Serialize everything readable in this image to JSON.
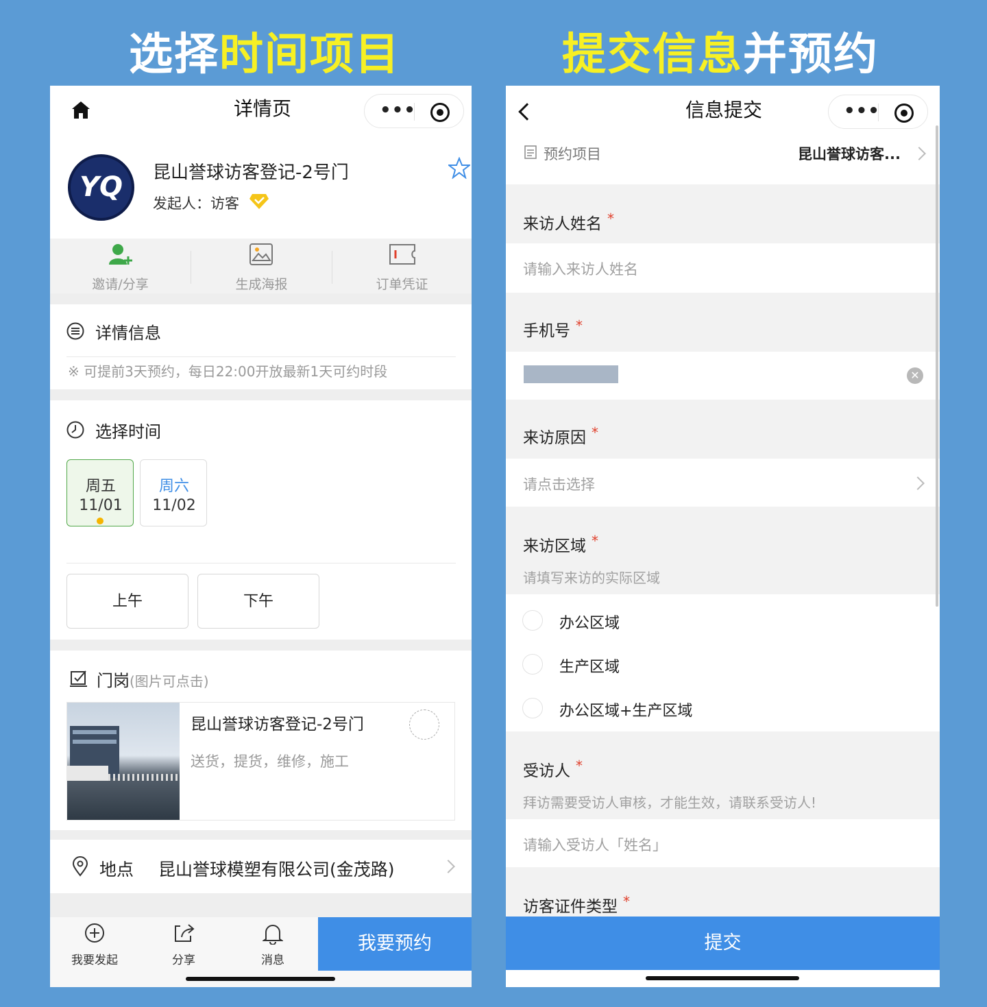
{
  "banners": {
    "left_white": "选择",
    "left_yellow": "时间项目",
    "right_yellow": "提交信息",
    "right_white": "并预约"
  },
  "detail_page": {
    "nav_title": "详情页",
    "capsule_dots": "•••",
    "header": {
      "logo_text": "YQ",
      "title": "昆山誉球访客登记-2号门",
      "initiator": "发起人：访客"
    },
    "actions": [
      "邀请/分享",
      "生成海报",
      "订单凭证"
    ],
    "details": {
      "heading": "详情信息",
      "note": "※ 可提前3天预约，每日22:00开放最新1天可约时段"
    },
    "time": {
      "heading": "选择时间",
      "days": [
        {
          "weekday": "周五",
          "date": "11/01"
        },
        {
          "weekday": "周六",
          "date": "11/02"
        }
      ],
      "slots": [
        "上午",
        "下午"
      ]
    },
    "gate": {
      "heading": "门岗",
      "hint": "(图片可点击)",
      "card_title": "昆山誉球访客登记-2号门",
      "card_desc": "送货，提货，维修，施工"
    },
    "location": {
      "label": "地点",
      "value": "昆山誉球模塑有限公司(金茂路)"
    },
    "tabbar": [
      "我要发起",
      "分享",
      "消息"
    ],
    "reserve_button": "我要预约",
    "colors": {
      "accent": "#3f8ee6",
      "selected_bg": "#eef7ea",
      "selected_border": "#52a84a",
      "star": "#3f8ee6"
    }
  },
  "submit_page": {
    "nav_title": "信息提交",
    "capsule_dots": "•••",
    "project": {
      "label": "预约项目",
      "value": "昆山誉球访客..."
    },
    "fields": {
      "name_label": "来访人姓名",
      "name_placeholder": "请输入来访人姓名",
      "phone_label": "手机号",
      "reason_label": "来访原因",
      "reason_placeholder": "请点击选择",
      "area_label": "来访区域",
      "area_hint": "请填写来访的实际区域",
      "area_options": [
        "办公区域",
        "生产区域",
        "办公区域+生产区域"
      ],
      "host_label": "受访人",
      "host_hint": "拜访需要受访人审核，才能生效，请联系受访人!",
      "host_placeholder": "请输入受访人「姓名」",
      "id_type_label": "访客证件类型",
      "required_mark": "*"
    },
    "submit_button": "提交"
  }
}
